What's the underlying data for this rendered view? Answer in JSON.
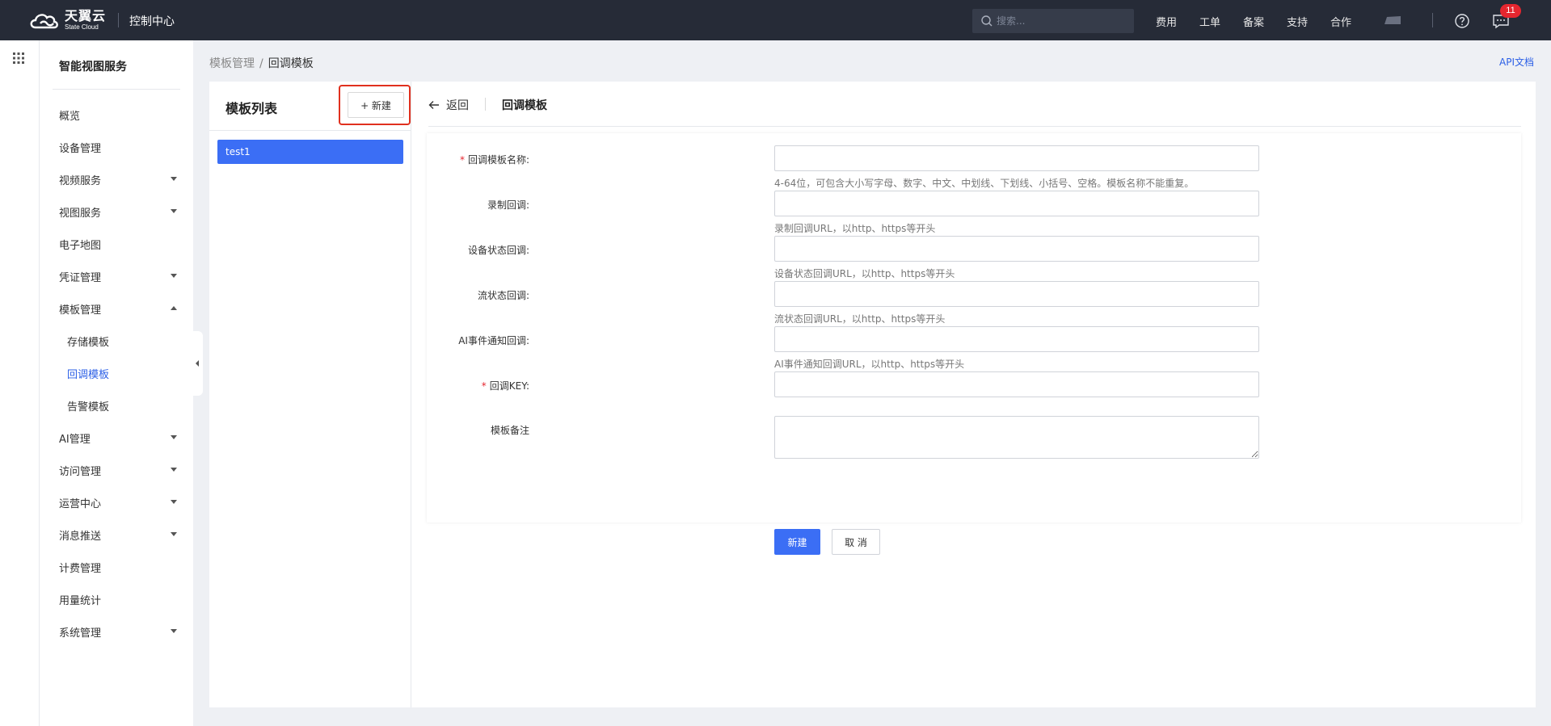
{
  "topbar": {
    "logo_main": "天翼云",
    "logo_sub": "State Cloud",
    "console_title": "控制中心",
    "search_placeholder": "搜索...",
    "nav": [
      "费用",
      "工单",
      "备案",
      "支持",
      "合作"
    ],
    "message_count": "11"
  },
  "sidebar": {
    "title": "智能视图服务",
    "items": [
      {
        "label": "概览"
      },
      {
        "label": "设备管理"
      },
      {
        "label": "视频服务"
      },
      {
        "label": "视图服务"
      },
      {
        "label": "电子地图"
      },
      {
        "label": "凭证管理"
      },
      {
        "label": "模板管理"
      },
      {
        "label": "存储模板"
      },
      {
        "label": "回调模板"
      },
      {
        "label": "告警模板"
      },
      {
        "label": "AI管理"
      },
      {
        "label": "访问管理"
      },
      {
        "label": "运营中心"
      },
      {
        "label": "消息推送"
      },
      {
        "label": "计费管理"
      },
      {
        "label": "用量统计"
      },
      {
        "label": "系统管理"
      }
    ]
  },
  "breadcrumb": {
    "parent": "模板管理",
    "separator": "/",
    "current": "回调模板"
  },
  "api_doc": "API文档",
  "template_list": {
    "title": "模板列表",
    "new_button": "+ 新建",
    "items": [
      "test1"
    ]
  },
  "form": {
    "back_label": "返回",
    "title": "回调模板",
    "fields": {
      "name_label": "回调模板名称:",
      "name_hint": "4-64位，可包含大小写字母、数字、中文、中划线、下划线、小括号、空格。模板名称不能重复。",
      "record_label": "录制回调:",
      "record_hint": "录制回调URL，以http、https等开头",
      "device_label": "设备状态回调:",
      "device_hint": "设备状态回调URL，以http、https等开头",
      "stream_label": "流状态回调:",
      "stream_hint": "流状态回调URL，以http、https等开头",
      "ai_label": "AI事件通知回调:",
      "ai_hint": "AI事件通知回调URL，以http、https等开头",
      "key_label": "回调KEY:",
      "remark_label": "模板备注"
    },
    "required_mark": "*",
    "submit": "新建",
    "cancel": "取 消"
  },
  "colors": {
    "topbar_bg": "#262b37",
    "primary": "#3b6ef5",
    "highlight_border": "#e0301e",
    "badge": "#e5262f"
  }
}
